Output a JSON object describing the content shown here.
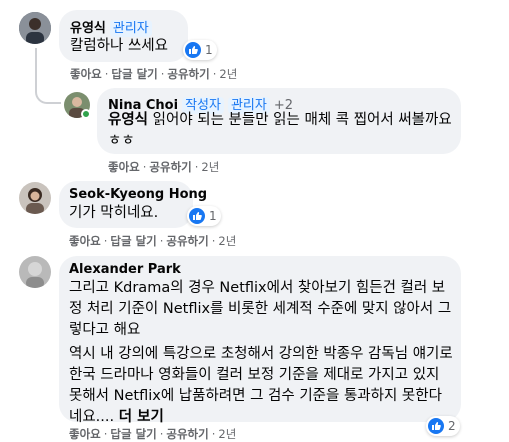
{
  "comments": [
    {
      "author": "유영식",
      "badge": "관리자",
      "text": "칼럼하나 쓰세요",
      "reaction_count": "1",
      "actions": {
        "like": "좋아요",
        "reply": "답글 달기",
        "share": "공유하기",
        "time": "2년"
      }
    },
    {
      "author": "Nina Choi",
      "badges": [
        "작성자",
        "관리자"
      ],
      "extra": "+2",
      "mention": "유영식",
      "text": " 읽어야 되는 분들만 읽는 매체 콕 찝어서 써볼까요 ㅎㅎ",
      "actions": {
        "like": "좋아요",
        "share": "공유하기",
        "time": "2년"
      }
    },
    {
      "author": "Seok-Kyeong Hong",
      "text": "기가 막히네요.",
      "reaction_count": "1",
      "actions": {
        "like": "좋아요",
        "reply": "답글 달기",
        "share": "공유하기",
        "time": "2년"
      }
    },
    {
      "author": "Alexander Park",
      "text_p1": "그리고 Kdrama의 경우 Netflix에서 찾아보기 힘든건 컬러 보정 처리 기준이 Netflix를 비롯한 세계적 수준에 맞지 않아서 그렇다고 해요",
      "text_p2": "역시 내 강의에 특강으로 초청해서 강의한 박종우 감독님 얘기로 한국 드라마나 영화들이 컬러 보정 기준을 제대로 가지고 있지 못해서 Netflix에 납품하려면 그 검수 기준을 통과하지 못한다네요....",
      "see_more": "더 보기",
      "reaction_count": "2",
      "actions": {
        "like": "좋아요",
        "reply": "답글 달기",
        "share": "공유하기",
        "time": "2년"
      }
    }
  ],
  "colors": {
    "bubble": "#f0f2f5",
    "link": "#1877f2",
    "muted": "#65676b"
  }
}
